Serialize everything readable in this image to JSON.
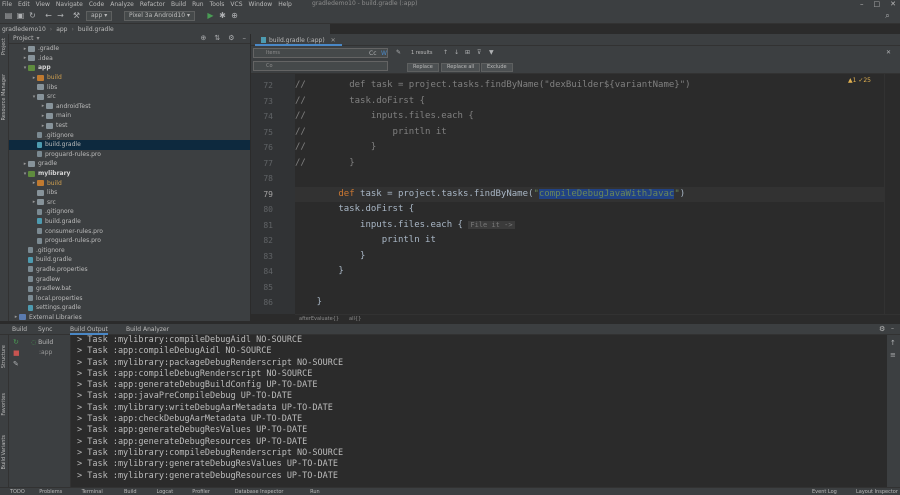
{
  "menu": {
    "items": [
      "File",
      "Edit",
      "View",
      "Navigate",
      "Code",
      "Analyze",
      "Refactor",
      "Build",
      "Run",
      "Tools",
      "VCS",
      "Window",
      "Help"
    ],
    "window_title": "gradledemo10 - build.gradle (:app)"
  },
  "window_controls": {
    "minimize": "–",
    "maximize": "□",
    "close": "✕"
  },
  "toolbar": {
    "run_config": "app",
    "device": "Pixel 3a Android10",
    "icons": [
      "folder-open-icon",
      "save-icon",
      "sync-icon",
      "back-icon",
      "forward-icon",
      "hammer-icon",
      "run-icon",
      "debug-icon",
      "search-icon"
    ]
  },
  "breadcrumbs": [
    "gradledemo10",
    "app",
    "build.gradle"
  ],
  "left_stripe": [
    "Project",
    "Resource Manager",
    "Structure",
    "Favorites",
    "Build Variants"
  ],
  "project_panel": {
    "title": "Project",
    "tree": [
      {
        "label": ".gradle",
        "depth": 1,
        "icon": "folder",
        "arrow": "▸"
      },
      {
        "label": ".idea",
        "depth": 1,
        "icon": "folder",
        "arrow": "▸"
      },
      {
        "label": "app",
        "depth": 1,
        "icon": "module",
        "arrow": "▾",
        "style": "bold"
      },
      {
        "label": "build",
        "depth": 2,
        "icon": "folder-o",
        "arrow": "▸",
        "style": "orange"
      },
      {
        "label": "libs",
        "depth": 2,
        "icon": "folder",
        "arrow": ""
      },
      {
        "label": "src",
        "depth": 2,
        "icon": "folder",
        "arrow": "▾"
      },
      {
        "label": "androidTest",
        "depth": 3,
        "icon": "folder",
        "arrow": "▸"
      },
      {
        "label": "main",
        "depth": 3,
        "icon": "folder",
        "arrow": "▸"
      },
      {
        "label": "test",
        "depth": 3,
        "icon": "folder",
        "arrow": "▸"
      },
      {
        "label": ".gitignore",
        "depth": 2,
        "icon": "file",
        "arrow": ""
      },
      {
        "label": "build.gradle",
        "depth": 2,
        "icon": "gradle",
        "arrow": "",
        "selected": true
      },
      {
        "label": "proguard-rules.pro",
        "depth": 2,
        "icon": "file",
        "arrow": ""
      },
      {
        "label": "gradle",
        "depth": 1,
        "icon": "folder",
        "arrow": "▸"
      },
      {
        "label": "mylibrary",
        "depth": 1,
        "icon": "module",
        "arrow": "▾",
        "style": "bold"
      },
      {
        "label": "build",
        "depth": 2,
        "icon": "folder-o",
        "arrow": "▸",
        "style": "orange"
      },
      {
        "label": "libs",
        "depth": 2,
        "icon": "folder",
        "arrow": ""
      },
      {
        "label": "src",
        "depth": 2,
        "icon": "folder",
        "arrow": "▸"
      },
      {
        "label": ".gitignore",
        "depth": 2,
        "icon": "file",
        "arrow": ""
      },
      {
        "label": "build.gradle",
        "depth": 2,
        "icon": "gradle",
        "arrow": ""
      },
      {
        "label": "consumer-rules.pro",
        "depth": 2,
        "icon": "file",
        "arrow": ""
      },
      {
        "label": "proguard-rules.pro",
        "depth": 2,
        "icon": "file",
        "arrow": ""
      },
      {
        "label": ".gitignore",
        "depth": 1,
        "icon": "file",
        "arrow": ""
      },
      {
        "label": "build.gradle",
        "depth": 1,
        "icon": "gradle",
        "arrow": ""
      },
      {
        "label": "gradle.properties",
        "depth": 1,
        "icon": "file",
        "arrow": ""
      },
      {
        "label": "gradlew",
        "depth": 1,
        "icon": "file",
        "arrow": ""
      },
      {
        "label": "gradlew.bat",
        "depth": 1,
        "icon": "file",
        "arrow": ""
      },
      {
        "label": "local.properties",
        "depth": 1,
        "icon": "file",
        "arrow": ""
      },
      {
        "label": "settings.gradle",
        "depth": 1,
        "icon": "gradle",
        "arrow": ""
      },
      {
        "label": "External Libraries",
        "depth": 0,
        "icon": "folder-b",
        "arrow": "▸"
      }
    ]
  },
  "editor": {
    "tab_label": "build.gradle (:app)",
    "find": {
      "search_placeholder": "Items",
      "replace_placeholder": "Co",
      "result_count": "1 results",
      "regex_label": "Regex",
      "replace_label": "Replace",
      "replace_all_label": "Replace all",
      "exclude_label": "Exclude"
    },
    "inspection": "▲1 ✓25",
    "lines": [
      {
        "no": "72",
        "segments": [
          {
            "t": "//",
            "c": "cm"
          },
          {
            "t": "        def task = project.tasks.findByName(\"dexBuilder${variantName}\")",
            "c": "cm"
          }
        ]
      },
      {
        "no": "73",
        "segments": [
          {
            "t": "//",
            "c": "cm"
          },
          {
            "t": "        task.doFirst {",
            "c": "cm"
          }
        ]
      },
      {
        "no": "74",
        "segments": [
          {
            "t": "//",
            "c": "cm"
          },
          {
            "t": "            inputs.files.each {",
            "c": "cm"
          }
        ]
      },
      {
        "no": "75",
        "segments": [
          {
            "t": "//",
            "c": "cm"
          },
          {
            "t": "                println it",
            "c": "cm"
          }
        ]
      },
      {
        "no": "76",
        "segments": [
          {
            "t": "//",
            "c": "cm"
          },
          {
            "t": "            }",
            "c": "cm"
          }
        ]
      },
      {
        "no": "77",
        "segments": [
          {
            "t": "//",
            "c": "cm"
          },
          {
            "t": "        }",
            "c": "cm"
          }
        ]
      },
      {
        "no": "78",
        "segments": [
          {
            "t": "",
            "c": ""
          }
        ]
      },
      {
        "no": "79",
        "caret": true,
        "segments": [
          {
            "t": "        ",
            "c": ""
          },
          {
            "t": "def",
            "c": "kw"
          },
          {
            "t": " task = project.tasks.findByName(",
            "c": ""
          },
          {
            "t": "\"",
            "c": "str"
          },
          {
            "t": "compileDebugJavaWithJavac",
            "c": "sel"
          },
          {
            "t": "\"",
            "c": "str"
          },
          {
            "t": ")",
            "c": ""
          }
        ]
      },
      {
        "no": "80",
        "segments": [
          {
            "t": "        task.doFirst {",
            "c": ""
          }
        ]
      },
      {
        "no": "81",
        "segments": [
          {
            "t": "            inputs.files.each { ",
            "c": ""
          },
          {
            "t": "File it ->",
            "c": "hint"
          }
        ]
      },
      {
        "no": "82",
        "segments": [
          {
            "t": "                println it",
            "c": ""
          }
        ]
      },
      {
        "no": "83",
        "segments": [
          {
            "t": "            }",
            "c": ""
          }
        ]
      },
      {
        "no": "84",
        "segments": [
          {
            "t": "        }",
            "c": ""
          }
        ]
      },
      {
        "no": "85",
        "segments": [
          {
            "t": "",
            "c": ""
          }
        ]
      },
      {
        "no": "86",
        "segments": [
          {
            "t": "    }",
            "c": ""
          }
        ]
      }
    ],
    "code_breadcrumb": [
      "afterEvaluate{}",
      "all{}"
    ]
  },
  "build_window": {
    "tabs": [
      "Build",
      "Sync",
      "Build Output",
      "Build Analyzer"
    ],
    "active_tab": "Build Output",
    "left_label": "Build",
    "left_sublabel": ":app",
    "output": [
      "> Task :mylibrary:compileDebugAidl NO-SOURCE",
      "> Task :app:compileDebugAidl NO-SOURCE",
      "> Task :mylibrary:packageDebugRenderscript NO-SOURCE",
      "> Task :app:compileDebugRenderscript NO-SOURCE",
      "> Task :app:generateDebugBuildConfig UP-TO-DATE",
      "> Task :app:javaPreCompileDebug UP-TO-DATE",
      "> Task :mylibrary:writeDebugAarMetadata UP-TO-DATE",
      "> Task :app:checkDebugAarMetadata UP-TO-DATE",
      "> Task :app:generateDebugResValues UP-TO-DATE",
      "> Task :app:generateDebugResources UP-TO-DATE",
      "> Task :mylibrary:compileDebugRenderscript NO-SOURCE",
      "> Task :mylibrary:generateDebugResValues UP-TO-DATE",
      "> Task :mylibrary:generateDebugResources UP-TO-DATE"
    ]
  },
  "statusbar": {
    "items": [
      "TODO",
      "Problems",
      "Terminal",
      "Build",
      "Logcat",
      "Profiler",
      "Database Inspector",
      "Run"
    ],
    "right_items": [
      "Event Log",
      "Layout Inspector"
    ]
  }
}
